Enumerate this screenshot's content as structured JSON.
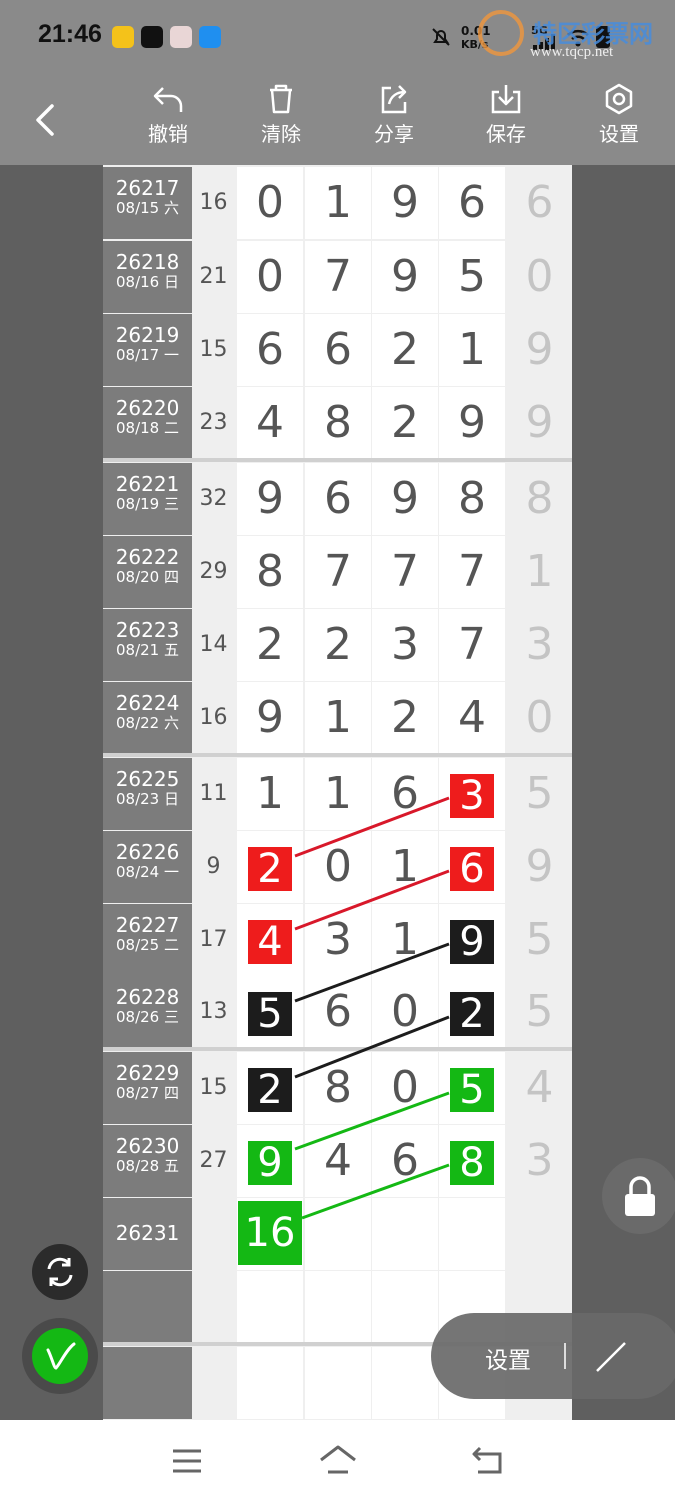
{
  "status": {
    "time": "21:46",
    "net_speed": "0.01",
    "net_unit": "KB/s",
    "signal_label": "5G",
    "watermark": "特区彩票网",
    "watermark_url": "www.tqcp.net"
  },
  "toolbar": {
    "undo": "撤销",
    "clear": "清除",
    "share": "分享",
    "save": "保存",
    "settings": "设置"
  },
  "rows": [
    {
      "issue": "26217",
      "date": "08/15 六",
      "sum": "16",
      "d": [
        "0",
        "1",
        "9",
        "6"
      ],
      "last": "6"
    },
    {
      "issue": "26218",
      "date": "08/16 日",
      "sum": "21",
      "d": [
        "0",
        "7",
        "9",
        "5"
      ],
      "last": "0"
    },
    {
      "issue": "26219",
      "date": "08/17 一",
      "sum": "15",
      "d": [
        "6",
        "6",
        "2",
        "1"
      ],
      "last": "9"
    },
    {
      "issue": "26220",
      "date": "08/18 二",
      "sum": "23",
      "d": [
        "4",
        "8",
        "2",
        "9"
      ],
      "last": "9"
    },
    {
      "issue": "26221",
      "date": "08/19 三",
      "sum": "32",
      "d": [
        "9",
        "6",
        "9",
        "8"
      ],
      "last": "8"
    },
    {
      "issue": "26222",
      "date": "08/20 四",
      "sum": "29",
      "d": [
        "8",
        "7",
        "7",
        "7"
      ],
      "last": "1"
    },
    {
      "issue": "26223",
      "date": "08/21 五",
      "sum": "14",
      "d": [
        "2",
        "2",
        "3",
        "7"
      ],
      "last": "3"
    },
    {
      "issue": "26224",
      "date": "08/22 六",
      "sum": "16",
      "d": [
        "9",
        "1",
        "2",
        "4"
      ],
      "last": "0"
    },
    {
      "issue": "26225",
      "date": "08/23 日",
      "sum": "11",
      "d": [
        "1",
        "1",
        "6",
        "3"
      ],
      "last": "5"
    },
    {
      "issue": "26226",
      "date": "08/24 一",
      "sum": "9",
      "d": [
        "2",
        "0",
        "1",
        "6"
      ],
      "last": "9"
    },
    {
      "issue": "26227",
      "date": "08/25 二",
      "sum": "17",
      "d": [
        "4",
        "3",
        "1",
        "9"
      ],
      "last": "5"
    },
    {
      "issue": "26228",
      "date": "08/26 三",
      "sum": "13",
      "d": [
        "5",
        "6",
        "0",
        "2"
      ],
      "last": "5"
    },
    {
      "issue": "26229",
      "date": "08/27 四",
      "sum": "15",
      "d": [
        "2",
        "8",
        "0",
        "5"
      ],
      "last": "4"
    },
    {
      "issue": "26230",
      "date": "08/28 五",
      "sum": "27",
      "d": [
        "9",
        "4",
        "6",
        "8"
      ],
      "last": "3"
    },
    {
      "issue": "26231",
      "date": "",
      "sum": "",
      "d": [
        "",
        "",
        "",
        ""
      ],
      "last": ""
    }
  ],
  "annotation": {
    "value": "16",
    "color": "#14b814"
  },
  "marker_colors": {
    "red": "#ee1c1c",
    "black": "#1c1c1c",
    "green": "#14b814"
  },
  "float_panel": {
    "settings_label": "设置"
  }
}
